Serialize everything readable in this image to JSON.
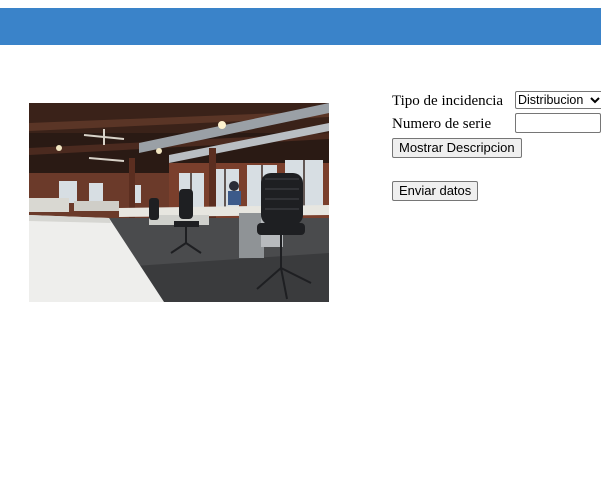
{
  "header": {
    "color": "#3a83c9"
  },
  "image": {
    "icon": "office-photo"
  },
  "form": {
    "incident_type_label": "Tipo de incidencia",
    "incident_type_selected": "Distribucion",
    "serial_label": "Numero de serie",
    "serial_value": "",
    "show_description_button": "Mostrar Descripcion",
    "send_button": "Enviar datos"
  }
}
